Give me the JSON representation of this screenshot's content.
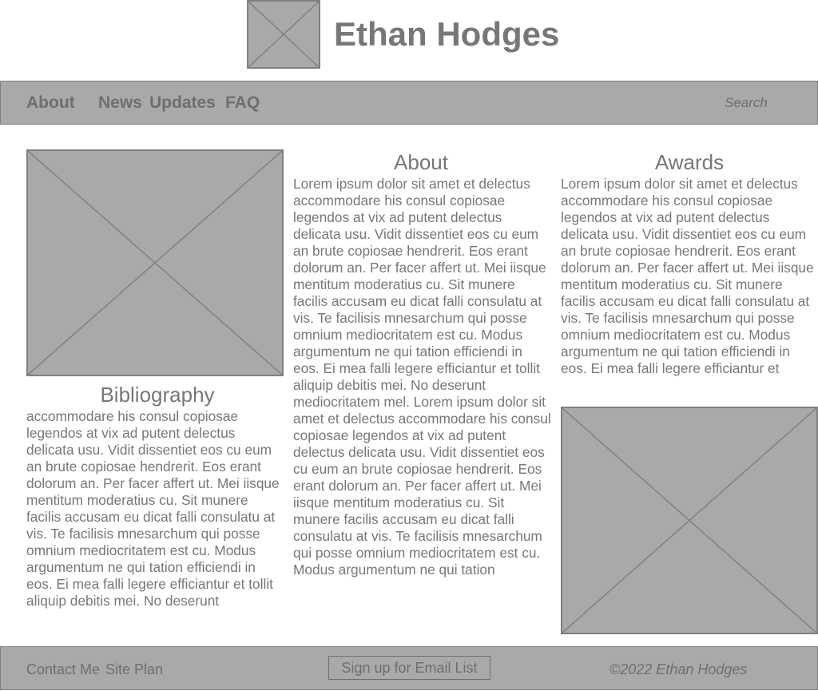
{
  "header": {
    "site_title": "Ethan Hodges",
    "logo": "image-placeholder-icon"
  },
  "nav": {
    "items": [
      {
        "label": "About"
      },
      {
        "label": "News"
      },
      {
        "label": "Updates"
      },
      {
        "label": "FAQ"
      }
    ],
    "search": {
      "placeholder": "Search",
      "value": ""
    }
  },
  "main": {
    "left": {
      "image": "image-placeholder-icon",
      "heading": "Bibliography",
      "text": "accommodare his consul copiosae legendos at vix ad putent delectus delicata usu. Vidit dissentiet eos cu eum an brute copiosae hendrerit. Eos erant dolorum an. Per facer affert ut. Mei iisque mentitum moderatius cu. Sit munere facilis accusam eu dicat falli consulatu at vis. Te facilisis mnesarchum qui posse omnium mediocritatem est cu. Modus argumentum ne qui tation efficiendi in eos. Ei mea falli legere efficiantur et tollit aliquip debitis mei. No deserunt"
    },
    "middle": {
      "heading": "About",
      "text": "Lorem ipsum dolor sit amet et delectus accommodare his consul copiosae legendos at vix ad putent delectus delicata usu. Vidit dissentiet eos cu eum an brute copiosae hendrerit. Eos erant dolorum an. Per facer affert ut. Mei iisque mentitum moderatius cu. Sit munere facilis accusam eu dicat falli consulatu at vis. Te facilisis mnesarchum qui posse omnium mediocritatem est cu. Modus argumentum ne qui tation efficiendi in eos. Ei mea falli legere efficiantur et tollit aliquip debitis mei. No deserunt mediocritatem mel. Lorem ipsum dolor sit amet et delectus accommodare his consul copiosae legendos at vix ad putent delectus delicata usu. Vidit dissentiet eos cu eum an brute copiosae hendrerit. Eos erant dolorum an. Per facer affert ut. Mei iisque mentitum moderatius cu. Sit munere facilis accusam eu dicat falli consulatu at vis. Te facilisis mnesarchum qui posse omnium mediocritatem est cu. Modus argumentum ne qui tation"
    },
    "right": {
      "heading": "Awards",
      "text": "Lorem ipsum dolor sit amet et delectus accommodare his consul copiosae legendos at vix ad putent delectus delicata usu. Vidit dissentiet eos cu eum an brute copiosae hendrerit. Eos erant dolorum an. Per facer affert ut. Mei iisque mentitum moderatius cu. Sit munere facilis accusam eu dicat falli consulatu at vis. Te facilisis mnesarchum qui posse omnium mediocritatem est cu. Modus argumentum ne qui tation efficiendi in eos. Ei mea falli legere efficiantur et",
      "image": "image-placeholder-icon"
    }
  },
  "footer": {
    "links": [
      {
        "label": "Contact Me"
      },
      {
        "label": "Site Plan"
      }
    ],
    "signup_label": "Sign up for Email List",
    "copyright": "©2022 Ethan Hodges"
  },
  "colors": {
    "placeholder_fill": "#a9a9a9",
    "placeholder_border": "#808080",
    "text": "#777777"
  }
}
